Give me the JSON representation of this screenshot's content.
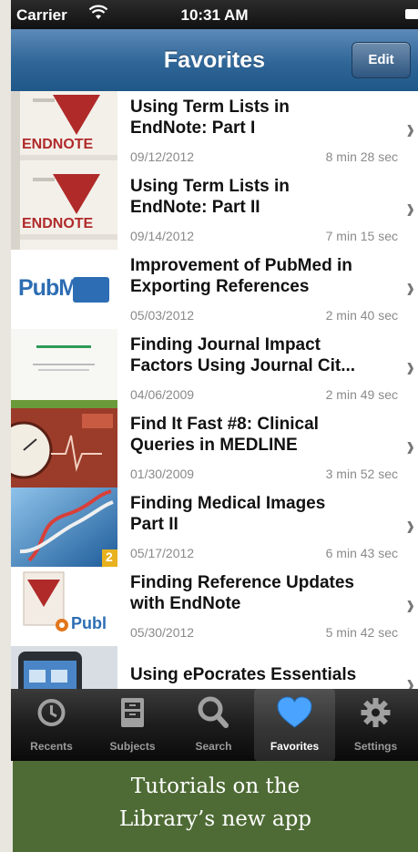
{
  "status_bar": {
    "carrier": "Carrier",
    "time": "10:31 AM"
  },
  "nav": {
    "title": "Favorites",
    "edit_label": "Edit"
  },
  "items": [
    {
      "title_line1": "Using Term Lists in",
      "title_line2": "EndNote: Part I",
      "date": "09/12/2012",
      "duration": "8 min 28 sec",
      "thumb_text": "ENDNOTE"
    },
    {
      "title_line1": "Using Term Lists in",
      "title_line2": "EndNote: Part II",
      "date": "09/14/2012",
      "duration": "7 min 15 sec",
      "thumb_text": "ENDNOTE"
    },
    {
      "title_line1": "Improvement of PubMed in",
      "title_line2": "Exporting References",
      "date": "05/03/2012",
      "duration": "2 min 40 sec",
      "thumb_text": "PubMed"
    },
    {
      "title_line1": "Finding Journal Impact",
      "title_line2": "Factors Using Journal Cit...",
      "date": "04/06/2009",
      "duration": "2 min 49 sec",
      "thumb_text": ""
    },
    {
      "title_line1": "Find It Fast #8: Clinical",
      "title_line2": "Queries in MEDLINE",
      "date": "01/30/2009",
      "duration": "3 min 52 sec",
      "thumb_text": ""
    },
    {
      "title_line1": "Finding Medical Images",
      "title_line2": "Part II",
      "date": "05/17/2012",
      "duration": "6 min 43 sec",
      "thumb_text": "2"
    },
    {
      "title_line1": "Finding Reference Updates",
      "title_line2": "with EndNote",
      "date": "05/30/2012",
      "duration": "5 min 42 sec",
      "thumb_text": "Publ"
    },
    {
      "title_line1": "Using ePocrates Essentials",
      "title_line2": "",
      "date": "",
      "duration": "",
      "thumb_text": ""
    }
  ],
  "tabs": [
    {
      "label": "Recents",
      "icon": "clock-icon",
      "active": false
    },
    {
      "label": "Subjects",
      "icon": "cabinet-icon",
      "active": false
    },
    {
      "label": "Search",
      "icon": "magnifier-icon",
      "active": false
    },
    {
      "label": "Favorites",
      "icon": "heart-icon",
      "active": true
    },
    {
      "label": "Settings",
      "icon": "gear-icon",
      "active": false
    }
  ],
  "caption": {
    "line1": "Tutorials on the",
    "line2": "Library’s new app"
  },
  "colors": {
    "nav_blue": "#2f6697",
    "caption_green": "#4e6b35",
    "endnote_red": "#b02a2a",
    "active_heart": "#4aa3ff"
  }
}
